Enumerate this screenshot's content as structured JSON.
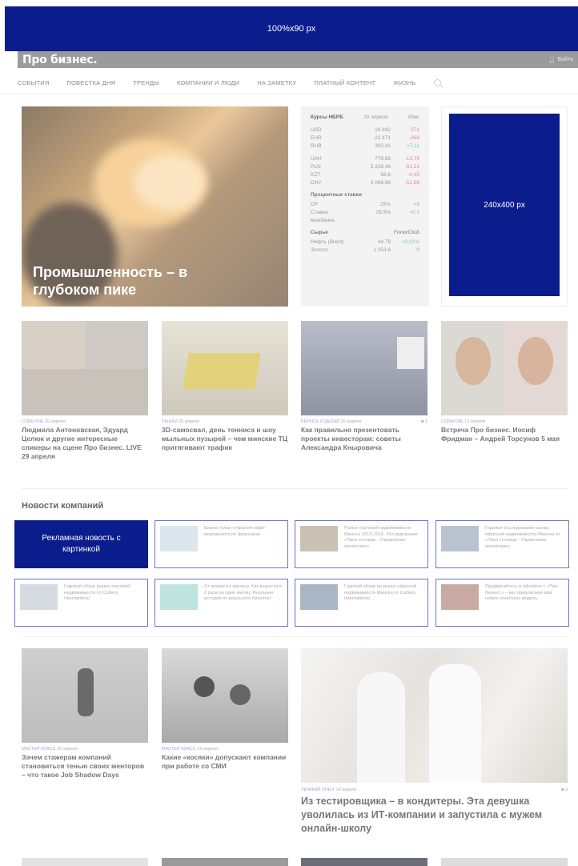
{
  "banner": {
    "label": "100%x90 px"
  },
  "header": {
    "logo": "Про бизнес.",
    "login": "Войти"
  },
  "nav": [
    "СОБЫТИЯ",
    "ПОВЕСТКА ДНЯ",
    "ТРЕНДЫ",
    "КОМПАНИИ И ЛЮДИ",
    "НА ЗАМЕТКУ",
    "ПЛАТНЫЙ КОНТЕНТ",
    "ЖИЗНЬ"
  ],
  "hero": {
    "title": "Промышленность – в глубоком пике"
  },
  "rates": {
    "title": "Курсы НБРБ",
    "date": "20 апреля",
    "change": "Изм.",
    "currencies": [
      {
        "n": "USD",
        "v": "19 842",
        "c": "-371",
        "s": "neg"
      },
      {
        "n": "EUR",
        "v": "22 471",
        "c": "-366",
        "s": "neg"
      },
      {
        "n": "RUB",
        "v": "302,41",
        "c": "+7,11",
        "s": "pos"
      },
      {
        "n": "UAH",
        "v": "779,65",
        "c": "-13,79",
        "s": "neg"
      },
      {
        "n": "PLN",
        "v": "5 226,46",
        "c": "-91,21",
        "s": "neg"
      },
      {
        "n": "KZT",
        "v": "58,6",
        "c": "-0,45",
        "s": "neg"
      },
      {
        "n": "CNY",
        "v": "3 066,98",
        "c": "-52,86",
        "s": "neg"
      }
    ],
    "rates_title": "Процентные ставки",
    "rates_rows": [
      {
        "n": "СР",
        "v": "25%",
        "c": "+6",
        "s": "pos"
      },
      {
        "n": "Ставка межбанка",
        "v": "29,9%",
        "c": "+0,1",
        "s": "pos"
      }
    ],
    "raw_title": "Сырье",
    "raw_logo": "ForexClub",
    "raw_rows": [
      {
        "n": "Нефть (Brent)",
        "v": "44,79",
        "c": "+0,02%",
        "s": "pos"
      },
      {
        "n": "Золото",
        "v": "1 253,6",
        "c": "0",
        "s": "pos"
      }
    ]
  },
  "ad240": {
    "label": "240x400 px"
  },
  "cards": [
    {
      "cat": "СОБЫТИЕ",
      "date": "20 апреля",
      "comments": "",
      "title": "Людмила Антоновская, Эдуард Целюк и другие интересные спикеры на сцене Про бизнес. LIVE 29 апреля"
    },
    {
      "cat": "РЫНКИ",
      "date": "20 апреля",
      "comments": "",
      "title": "3D-самосвал, день тенниса и шоу мыльных пузырей – чем минские ТЦ притягивают трафик"
    },
    {
      "cat": "БЕРИСЬ И ДЕЛАЙ",
      "date": "20 апреля",
      "comments": "1",
      "title": "Как правильно презентовать проекты инвесторам: советы Александра Кныровича"
    },
    {
      "cat": "СОБЫТИЕ",
      "date": "13 апреля",
      "comments": "",
      "title": "Встреча Про бизнес. Иосиф Фридман – Андрей Торсунов 5 мая"
    }
  ],
  "company_news": {
    "title": "Новости компаний",
    "ad": "Рекламная новость с картинкой",
    "items": [
      "Бизнес-план открытия кафе-мороженого по франшизе",
      "Рынок торговой недвижимости Минска 2015-2016. Исследование «Твоя столица · Управление проектами»",
      "Годовое исследование рынка офисной недвижимости Минска от «Твоя столица · Управление проектами»",
      "Годовой обзор рынка торговой недвижимости от Colliers International",
      "От кризиса к кризису. Как вырасти в 2 раза за один месяц! Реальная история от реального бизнеса!",
      "Годовой обзор по рынку офисной недвижимости Минска от Colliers International",
      "Продвигайтесь в офлайне с «Про бизнес.» – мы предлагаем вам новую понятную модель"
    ]
  },
  "cards2": [
    {
      "cat": "МАСТЕР-КЛАСС",
      "date": "20 апреля",
      "title": "Зачем стажерам компаний становиться тенью своих менторов – что такое Job Shadow Days"
    },
    {
      "cat": "МАСТЕР-КЛАСС",
      "date": "19 апреля",
      "title": "Какие «косяки» допускают компании при работе со СМИ"
    }
  ],
  "big": {
    "cat": "ЛИЧНЫЙ ОПЫТ",
    "date": "18 апреля",
    "comments": "3",
    "title": "Из тестировщика – в кондитеры. Эта девушка уволилась из ИТ-компании и запустила с мужем онлайн-школу"
  }
}
